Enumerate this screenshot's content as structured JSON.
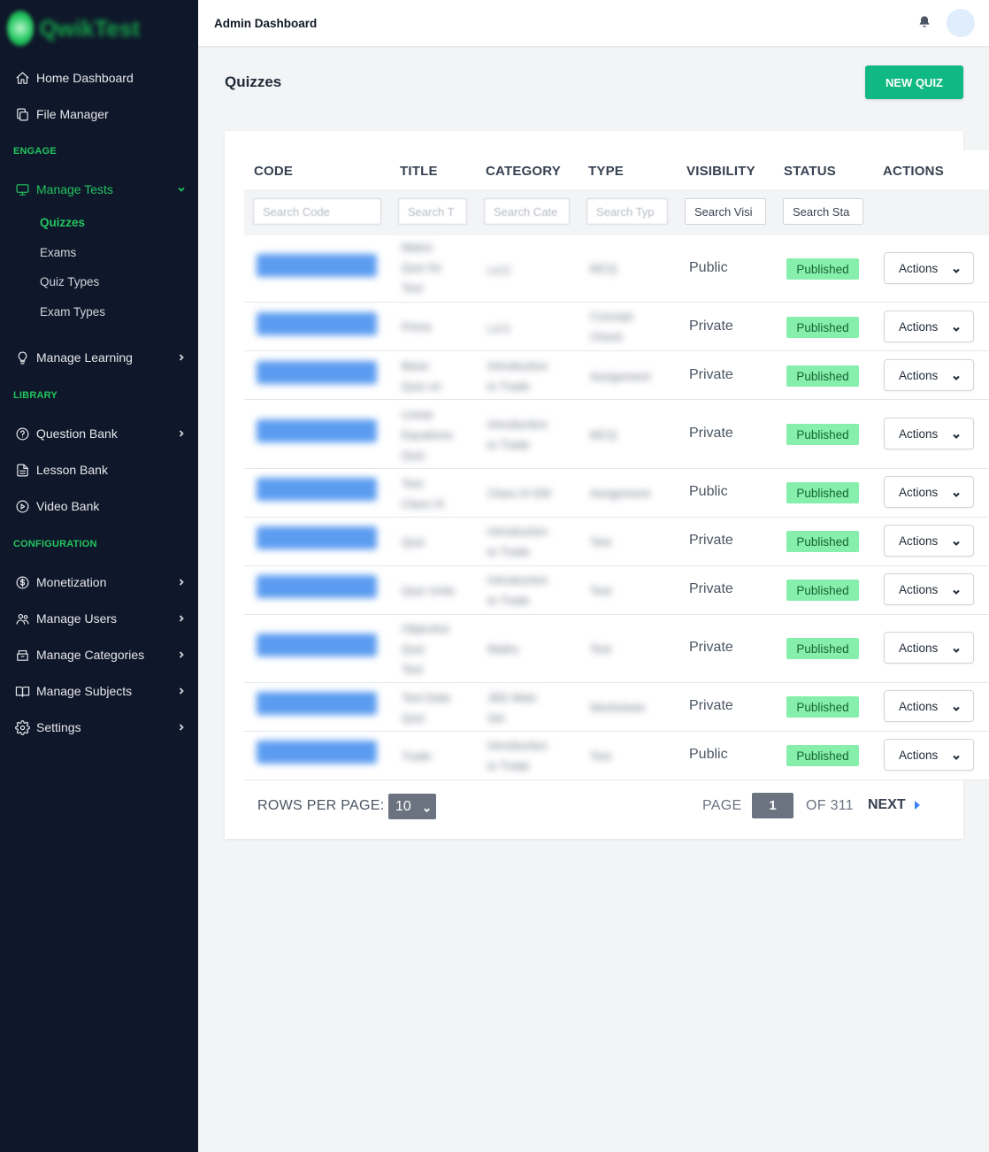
{
  "sidebar": {
    "top_items": [
      {
        "label": "Home Dashboard",
        "icon": "home-icon"
      },
      {
        "label": "File Manager",
        "icon": "copy-icon"
      }
    ],
    "engage_label": "ENGAGE",
    "manage_tests": {
      "label": "Manage Tests",
      "icon": "monitor-icon",
      "expanded": true
    },
    "manage_tests_sub": [
      {
        "label": "Quizzes",
        "active": true
      },
      {
        "label": "Exams"
      },
      {
        "label": "Quiz Types"
      },
      {
        "label": "Exam Types"
      }
    ],
    "manage_learning": {
      "label": "Manage Learning",
      "icon": "lightbulb-icon"
    },
    "library_label": "LIBRARY",
    "library_items": [
      {
        "label": "Question Bank",
        "icon": "question-circle-icon"
      },
      {
        "label": "Lesson Bank",
        "icon": "document-icon"
      },
      {
        "label": "Video Bank",
        "icon": "play-circle-icon"
      }
    ],
    "configuration_label": "CONFIGURATION",
    "config_items": [
      {
        "label": "Monetization",
        "icon": "dollar-circle-icon"
      },
      {
        "label": "Manage Users",
        "icon": "users-icon"
      },
      {
        "label": "Manage Categories",
        "icon": "archive-icon"
      },
      {
        "label": "Manage Subjects",
        "icon": "book-icon"
      },
      {
        "label": "Settings",
        "icon": "gear-icon"
      }
    ]
  },
  "topbar": {
    "title": "Admin Dashboard",
    "notification_icon": "bell-icon"
  },
  "page": {
    "title": "Quizzes",
    "new_button": "NEW QUIZ"
  },
  "table": {
    "columns": [
      "CODE",
      "TITLE",
      "CATEGORY",
      "TYPE",
      "VISIBILITY",
      "STATUS",
      "ACTIONS"
    ],
    "filters": [
      {
        "placeholder": "Search Code"
      },
      {
        "placeholder": "Search T"
      },
      {
        "placeholder": "Search Cate"
      },
      {
        "placeholder": "Search Typ"
      },
      {
        "placeholder": "Search Visi"
      },
      {
        "placeholder": "Search Sta"
      }
    ],
    "rows": [
      {
        "visibility": "Public",
        "status": "Published",
        "action": "Actions"
      },
      {
        "visibility": "Private",
        "status": "Published",
        "action": "Actions"
      },
      {
        "visibility": "Private",
        "status": "Published",
        "action": "Actions"
      },
      {
        "visibility": "Private",
        "status": "Published",
        "action": "Actions"
      },
      {
        "visibility": "Public",
        "status": "Published",
        "action": "Actions"
      },
      {
        "visibility": "Private",
        "status": "Published",
        "action": "Actions"
      },
      {
        "visibility": "Private",
        "status": "Published",
        "action": "Actions"
      },
      {
        "visibility": "Private",
        "status": "Published",
        "action": "Actions"
      },
      {
        "visibility": "Private",
        "status": "Published",
        "action": "Actions"
      },
      {
        "visibility": "Public",
        "status": "Published",
        "action": "Actions"
      }
    ]
  },
  "pagination": {
    "rows_per_page_label": "ROWS PER PAGE:",
    "rows_per_page_value": "10",
    "page_label": "PAGE",
    "current_page": "1",
    "of_label": "OF 311",
    "next_label": "NEXT"
  },
  "colors": {
    "sidebar_bg": "#0f172a",
    "accent": "#22c55e",
    "primary_button": "#10b981",
    "status_badge": "#86efac",
    "code_pill": "#5b9cf0"
  }
}
